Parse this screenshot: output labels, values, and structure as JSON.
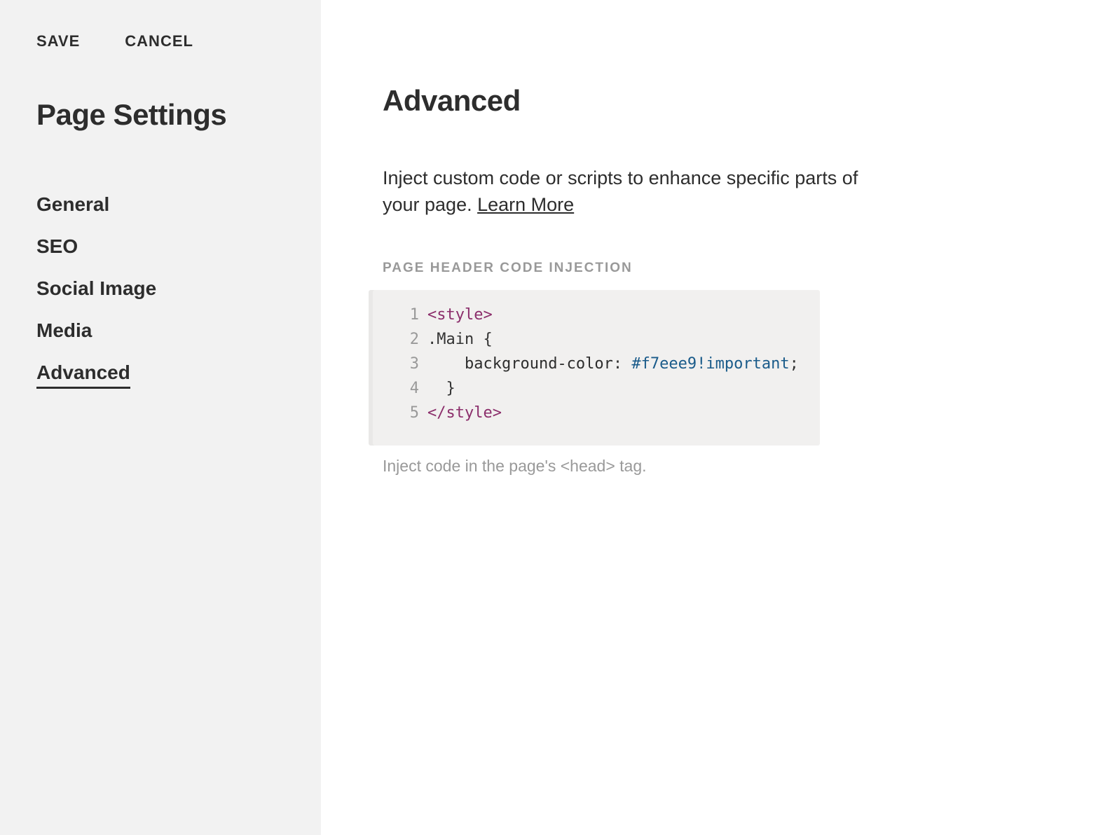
{
  "sidebar": {
    "save_label": "SAVE",
    "cancel_label": "CANCEL",
    "title": "Page Settings",
    "nav": [
      {
        "label": "General",
        "active": false
      },
      {
        "label": "SEO",
        "active": false
      },
      {
        "label": "Social Image",
        "active": false
      },
      {
        "label": "Media",
        "active": false
      },
      {
        "label": "Advanced",
        "active": true
      }
    ]
  },
  "main": {
    "title": "Advanced",
    "description_part1": "Inject custom code or scripts to enhance specific parts of your page. ",
    "learn_more_label": "Learn More",
    "section_label": "PAGE HEADER CODE INJECTION",
    "helper_text": "Inject code in the page's <head> tag.",
    "code": {
      "lines": [
        {
          "n": "1",
          "tokens": [
            {
              "t": "<style>",
              "c": "tok-tag"
            }
          ]
        },
        {
          "n": "2",
          "tokens": [
            {
              "t": ".Main {",
              "c": "tok-text"
            }
          ]
        },
        {
          "n": "3",
          "tokens": [
            {
              "t": "    ",
              "c": "tok-text"
            },
            {
              "t": "background-color",
              "c": "tok-prop"
            },
            {
              "t": ": ",
              "c": "tok-text"
            },
            {
              "t": "#f7eee9",
              "c": "tok-val"
            },
            {
              "t": "!important",
              "c": "tok-important"
            },
            {
              "t": ";",
              "c": "tok-text"
            }
          ]
        },
        {
          "n": "4",
          "tokens": [
            {
              "t": "  }",
              "c": "tok-text"
            }
          ]
        },
        {
          "n": "5",
          "tokens": [
            {
              "t": "</style>",
              "c": "tok-tag"
            }
          ]
        }
      ]
    }
  }
}
